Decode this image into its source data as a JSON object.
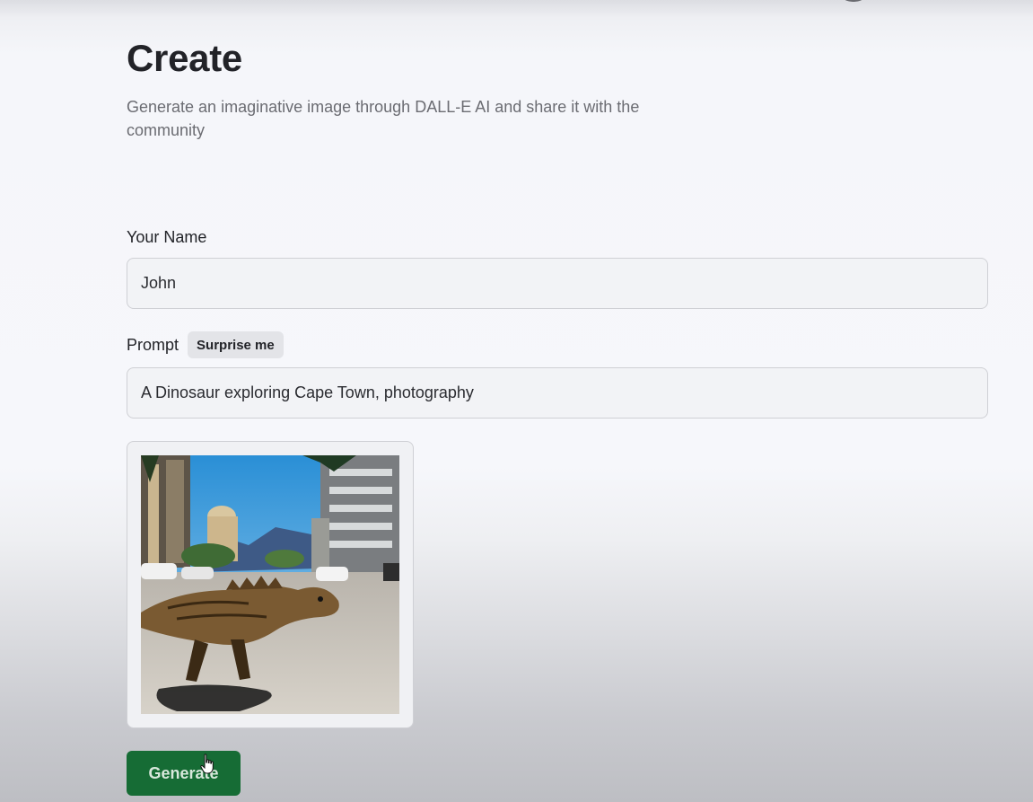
{
  "page": {
    "title": "Create",
    "subtitle": "Generate an imaginative image through DALL-E AI and share it with the community"
  },
  "form": {
    "name_label": "Your Name",
    "name_value": "John",
    "prompt_label": "Prompt",
    "surprise_label": "Surprise me",
    "prompt_value": "A Dinosaur exploring Cape Town, photography",
    "generate_label": "Generate"
  },
  "preview": {
    "icon": "generated-image",
    "alt": "A Dinosaur exploring Cape Town, photography"
  },
  "colors": {
    "accent": "#166c35",
    "text": "#222328",
    "muted": "#6b6c72"
  }
}
